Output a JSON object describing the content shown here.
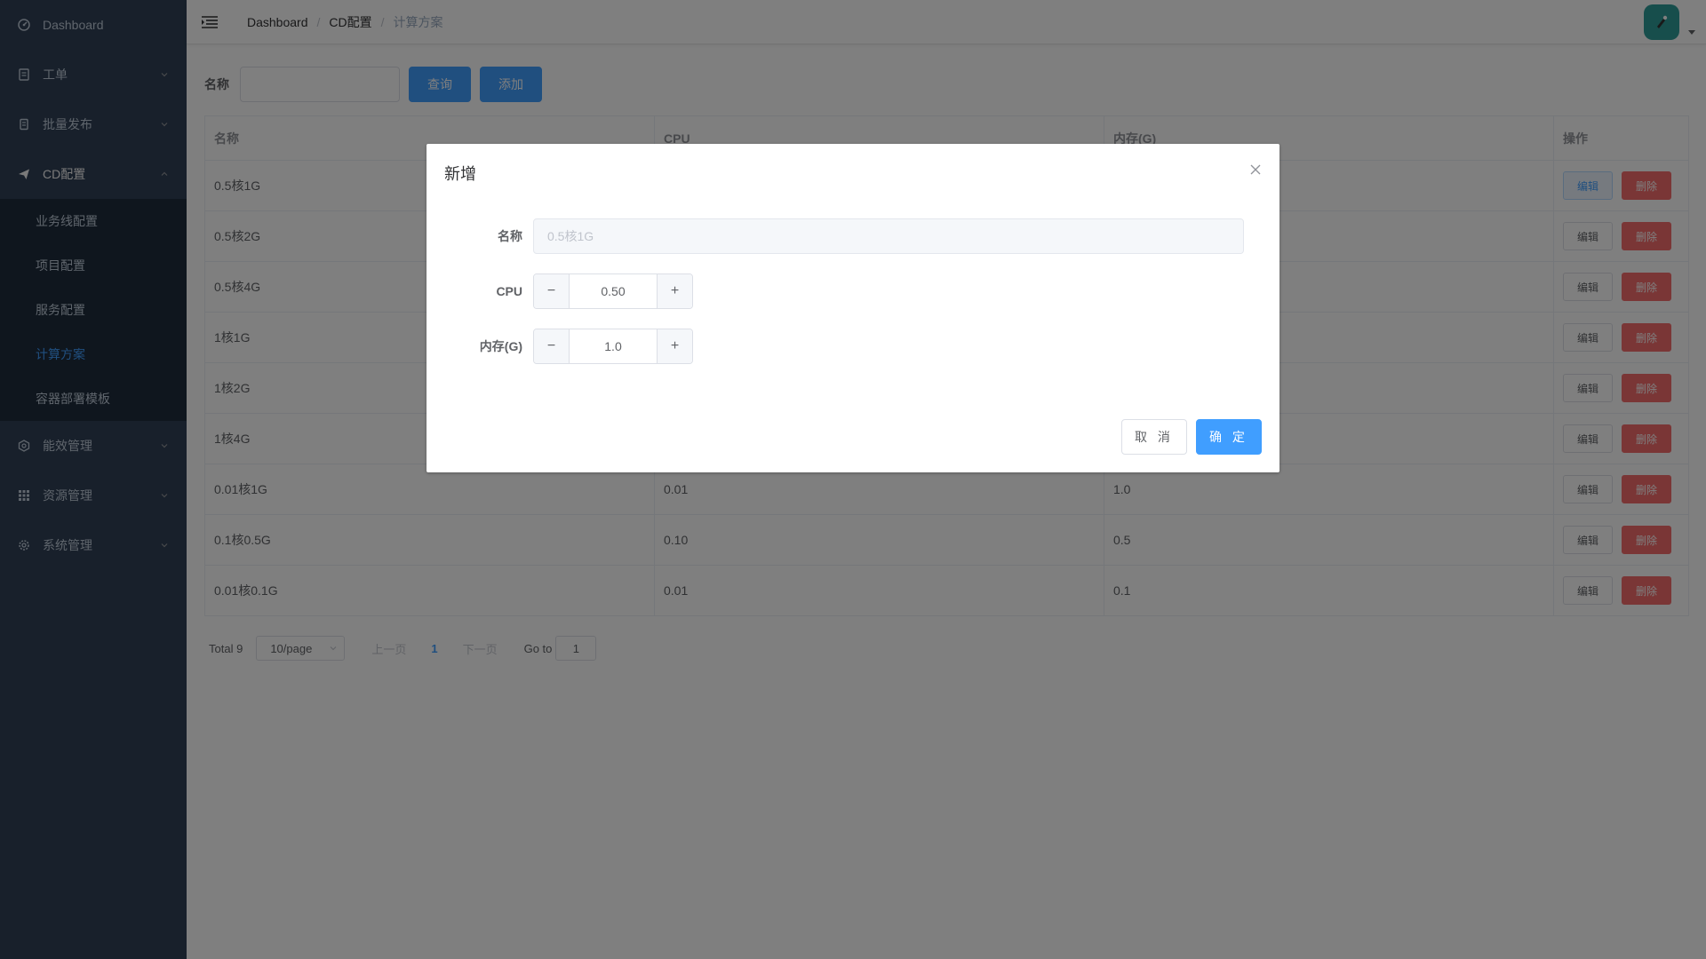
{
  "sidebar": {
    "items": [
      {
        "label": "Dashboard",
        "icon": "dashboard-icon"
      },
      {
        "label": "工单",
        "icon": "ticket-icon"
      },
      {
        "label": "批量发布",
        "icon": "batch-publish-icon"
      },
      {
        "label": "CD配置",
        "icon": "send-icon"
      }
    ],
    "cd_sub": [
      {
        "label": "业务线配置"
      },
      {
        "label": "项目配置"
      },
      {
        "label": "服务配置"
      },
      {
        "label": "计算方案"
      },
      {
        "label": "容器部署模板"
      }
    ],
    "items_after": [
      {
        "label": "能效管理",
        "icon": "efficiency-icon"
      },
      {
        "label": "资源管理",
        "icon": "grid-icon"
      },
      {
        "label": "系统管理",
        "icon": "gear-icon"
      }
    ]
  },
  "breadcrumb": [
    "Dashboard",
    "CD配置",
    "计算方案"
  ],
  "filter": {
    "label": "名称",
    "query_button": "查询",
    "add_button": "添加"
  },
  "table": {
    "headers": [
      "名称",
      "CPU",
      "内存(G)",
      "操作"
    ],
    "edit_label": "编辑",
    "delete_label": "删除",
    "rows": [
      {
        "name": "0.5核1G",
        "cpu": "",
        "mem": ""
      },
      {
        "name": "0.5核2G",
        "cpu": "",
        "mem": ""
      },
      {
        "name": "0.5核4G",
        "cpu": "",
        "mem": ""
      },
      {
        "name": "1核1G",
        "cpu": "",
        "mem": ""
      },
      {
        "name": "1核2G",
        "cpu": "",
        "mem": ""
      },
      {
        "name": "1核4G",
        "cpu": "",
        "mem": ""
      },
      {
        "name": "0.01核1G",
        "cpu": "0.01",
        "mem": "1.0"
      },
      {
        "name": "0.1核0.5G",
        "cpu": "0.10",
        "mem": "0.5"
      },
      {
        "name": "0.01核0.1G",
        "cpu": "0.01",
        "mem": "0.1"
      }
    ]
  },
  "pagination": {
    "total": "Total 9",
    "page_size": "10/page",
    "prev": "上一页",
    "current": "1",
    "next": "下一页",
    "goto_label": "Go to",
    "goto_value": "1"
  },
  "dialog": {
    "title": "新增",
    "name_label": "名称",
    "name_placeholder": "0.5核1G",
    "cpu_label": "CPU",
    "cpu_value": "0.50",
    "mem_label": "内存(G)",
    "mem_value": "1.0",
    "cancel": "取 消",
    "confirm": "确 定"
  },
  "colors": {
    "sidebar_bg": "#304156",
    "submenu_bg": "#1f2d3d",
    "primary": "#409eff",
    "danger": "#f56c6c",
    "avatar": "#2f9c99"
  }
}
